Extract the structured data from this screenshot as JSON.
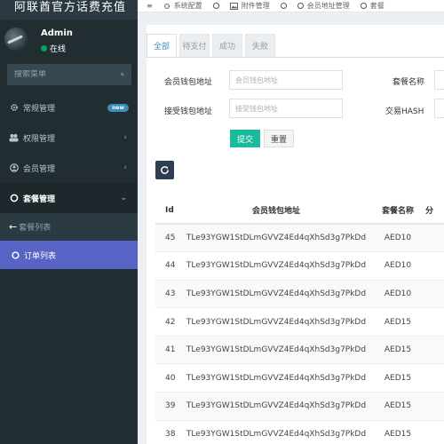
{
  "app": {
    "title": "阿联酋官方话费充值"
  },
  "user": {
    "name": "Admin",
    "status": "在线"
  },
  "search": {
    "placeholder": "搜索菜单"
  },
  "menu": {
    "items": [
      {
        "label": "常规管理",
        "icon": "gear-icon",
        "badge": "new"
      },
      {
        "label": "权限管理",
        "icon": "users-icon",
        "arrow": "‹"
      },
      {
        "label": "会员管理",
        "icon": "user-icon",
        "arrow": "‹"
      },
      {
        "label": "套餐管理",
        "icon": "circle-icon",
        "arrow": "⌄"
      }
    ],
    "submenu": [
      {
        "label": "套餐列表"
      },
      {
        "label": "订单列表"
      }
    ]
  },
  "topbar": {
    "items": [
      {
        "label": "≡",
        "icon": ""
      },
      {
        "label": "系统配置",
        "icon": "gear-icon"
      },
      {
        "label": "",
        "icon": "circle-icon"
      },
      {
        "label": "附件管理",
        "icon": "image-icon"
      },
      {
        "label": "",
        "icon": "circle-icon"
      },
      {
        "label": "会员地址管理",
        "icon": "circle-icon"
      },
      {
        "label": "套餐",
        "icon": "circle-icon"
      }
    ]
  },
  "tabs": [
    {
      "label": "全部",
      "active": true
    },
    {
      "label": "待支付",
      "active": false
    },
    {
      "label": "成功",
      "active": false
    },
    {
      "label": "失败",
      "active": false
    }
  ],
  "form": {
    "member_wallet": {
      "label": "会员钱包地址",
      "placeholder": "会员钱包地址"
    },
    "receive_wallet": {
      "label": "接受钱包地址",
      "placeholder": "接受钱包地址"
    },
    "package_name": {
      "label": "套餐名称"
    },
    "tx_hash": {
      "label": "交易HASH"
    },
    "submit_label": "提交",
    "reset_label": "重置"
  },
  "table": {
    "headers": {
      "id": "Id",
      "addr": "会员钱包地址",
      "pkg": "套餐名称",
      "rest": "分"
    },
    "rows": [
      {
        "id": "45",
        "addr": "TLe93YGW1StDLmGVVZ4Ed4qXhSd3g7PkDd",
        "pkg": "AED10"
      },
      {
        "id": "44",
        "addr": "TLe93YGW1StDLmGVVZ4Ed4qXhSd3g7PkDd",
        "pkg": "AED10"
      },
      {
        "id": "43",
        "addr": "TLe93YGW1StDLmGVVZ4Ed4qXhSd3g7PkDd",
        "pkg": "AED10"
      },
      {
        "id": "42",
        "addr": "TLe93YGW1StDLmGVVZ4Ed4qXhSd3g7PkDd",
        "pkg": "AED15"
      },
      {
        "id": "41",
        "addr": "TLe93YGW1StDLmGVVZ4Ed4qXhSd3g7PkDd",
        "pkg": "AED15"
      },
      {
        "id": "40",
        "addr": "TLe93YGW1StDLmGVVZ4Ed4qXhSd3g7PkDd",
        "pkg": "AED15"
      },
      {
        "id": "39",
        "addr": "TLe93YGW1StDLmGVVZ4Ed4qXhSd3g7PkDd",
        "pkg": "AED15"
      },
      {
        "id": "38",
        "addr": "TLe93YGW1StDLmGVVZ4Ed4qXhSd3g7PkDd",
        "pkg": "AED15"
      }
    ]
  },
  "colors": {
    "sidebar": "#222d32",
    "accent": "#3c8dbc",
    "active_sub": "#5764c6",
    "submit": "#18bc9c",
    "online": "#00a65a",
    "refresh": "#2c3e50"
  }
}
